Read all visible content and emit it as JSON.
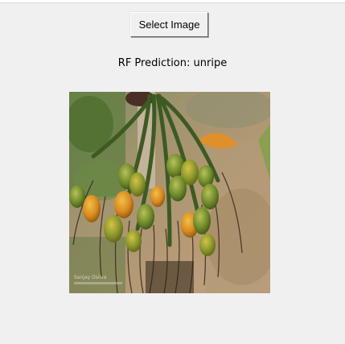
{
  "app": {
    "select_button_label": "Select Image",
    "prediction_text": "RF Prediction: unripe"
  },
  "image": {
    "subject": "areca-nut-cluster-photo",
    "watermark": "Sanjay Dsilva"
  },
  "colors": {
    "window_bg": "#f0f0f0",
    "button_bg": "#f0f0f0",
    "text": "#000000"
  }
}
